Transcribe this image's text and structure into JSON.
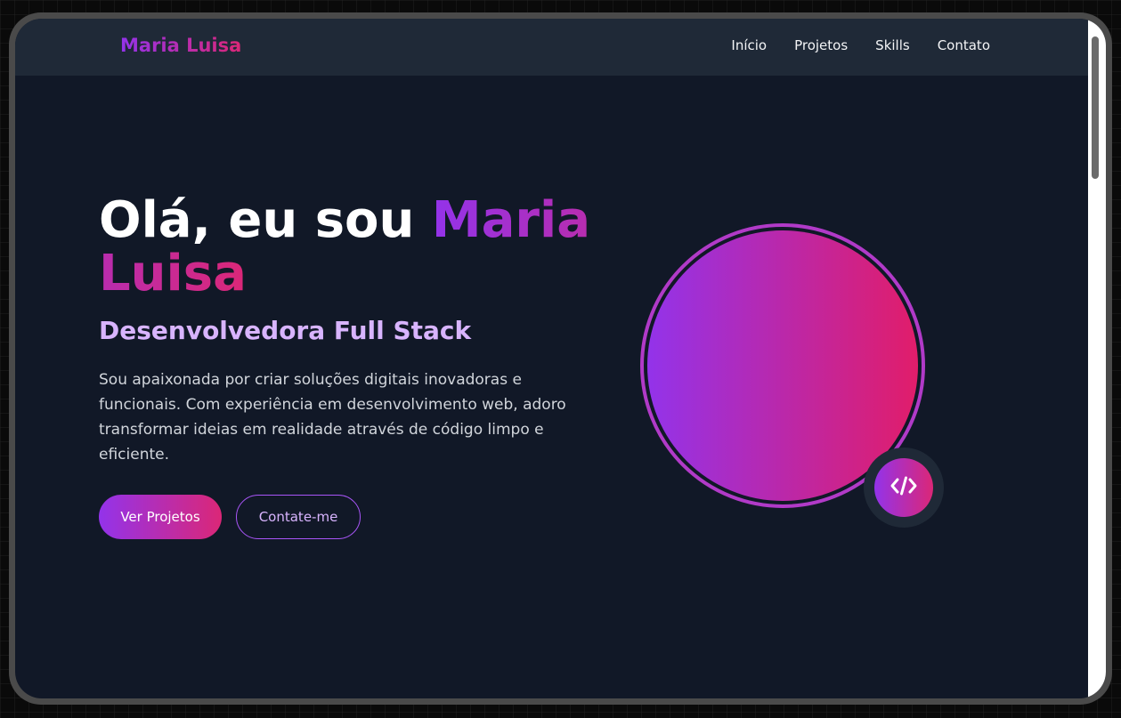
{
  "navbar": {
    "brand": "Maria Luisa",
    "links": [
      "Início",
      "Projetos",
      "Skills",
      "Contato"
    ]
  },
  "hero": {
    "greeting": "Olá, eu sou ",
    "name": "Maria Luisa",
    "subtitle": "Desenvolvedora Full Stack",
    "description": "Sou apaixonada por criar soluções digitais inovadoras e funcionais. Com experiência em desenvolvimento web, adoro transformar ideias em realidade através de código limpo e eficiente.",
    "primary_button": "Ver Projetos",
    "secondary_button": "Contate-me",
    "avatar_alt_fragment": "a",
    "badge_icon": "code-icon"
  },
  "colors": {
    "accent_purple": "#9333ea",
    "accent_pink": "#db2777",
    "background": "#111827",
    "navbar": "#1f2937"
  }
}
